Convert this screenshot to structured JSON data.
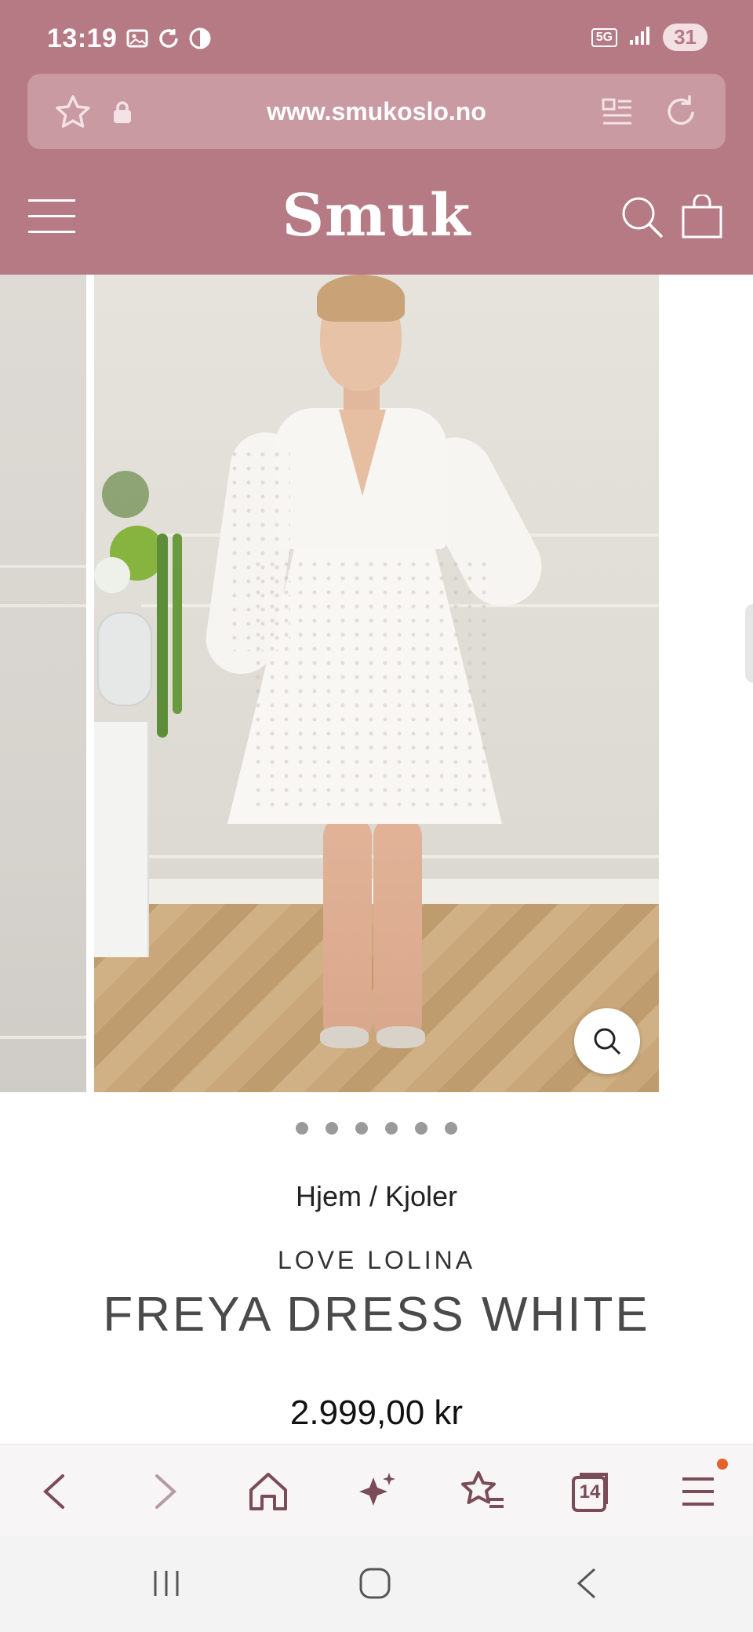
{
  "status_bar": {
    "time": "13:19",
    "network": "5G",
    "battery": "31"
  },
  "browser": {
    "url": "www.smukoslo.no",
    "tab_count": "14"
  },
  "site": {
    "logo": "Smuk"
  },
  "product": {
    "breadcrumb_home": "Hjem",
    "breadcrumb_sep": " / ",
    "breadcrumb_category": "Kjoler",
    "brand": "LOVE LOLINA",
    "title": "FREYA DRESS WHITE",
    "price": "2.999,00 kr",
    "gallery_image_count": 6,
    "active_image_index": 1
  },
  "colors": {
    "header_bg": "#b57a84",
    "urlbar_bg": "#c99aa2",
    "toolbar_icon": "#7a4b58",
    "notification_dot": "#e2622a"
  },
  "icons": {
    "bookmark": "star-icon",
    "secure": "lock-icon",
    "reader": "reader-mode-icon",
    "reload": "reload-icon",
    "menu": "hamburger-menu-icon",
    "search": "search-icon",
    "cart": "shopping-bag-icon",
    "zoom": "zoom-icon"
  }
}
